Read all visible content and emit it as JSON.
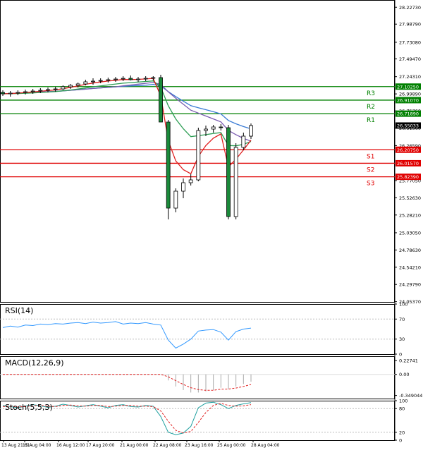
{
  "chart_data": {
    "type": "candlestick",
    "price_axis_ticks": [
      "28.22730",
      "27.98790",
      "27.73080",
      "27.49470",
      "27.24310",
      "26.99890",
      "26.75760",
      "26.51560",
      "26.26590",
      "25.77050",
      "25.52630",
      "25.28210",
      "25.03050",
      "24.78630",
      "24.54210",
      "24.29790",
      "24.05370"
    ],
    "x_ticks": [
      "13 Aug 21:01",
      "15 Aug 04:00",
      "16 Aug 12:00",
      "17 Aug 20:00",
      "21 Aug 00:00",
      "22 Aug 08:00",
      "23 Aug 16:00",
      "25 Aug 00:00",
      "28 Aug 04:00"
    ],
    "current_price": "26.55033",
    "price_range": [
      24.05,
      28.33
    ],
    "levels": [
      {
        "label": "R3",
        "value": "27.10250",
        "color": "#008000"
      },
      {
        "label": "R2",
        "value": "26.91070",
        "color": "#008000"
      },
      {
        "label": "R1",
        "value": "26.71890",
        "color": "#008000"
      },
      {
        "label": "S1",
        "value": "26.20750",
        "color": "#e00000"
      },
      {
        "label": "S2",
        "value": "26.01570",
        "color": "#e00000"
      },
      {
        "label": "S3",
        "value": "25.82390",
        "color": "#e00000"
      }
    ],
    "candles": [
      [
        27.02,
        27.05,
        26.97,
        27.0
      ],
      [
        27.0,
        27.04,
        26.96,
        27.01
      ],
      [
        27.01,
        27.05,
        26.98,
        27.02
      ],
      [
        27.02,
        27.06,
        26.99,
        27.03
      ],
      [
        27.03,
        27.07,
        27.0,
        27.04
      ],
      [
        27.04,
        27.08,
        27.01,
        27.05
      ],
      [
        27.05,
        27.09,
        27.02,
        27.06
      ],
      [
        27.06,
        27.1,
        27.03,
        27.07
      ],
      [
        27.07,
        27.12,
        27.05,
        27.1
      ],
      [
        27.1,
        27.14,
        27.07,
        27.12
      ],
      [
        27.12,
        27.16,
        27.09,
        27.14
      ],
      [
        27.14,
        27.2,
        27.12,
        27.17
      ],
      [
        27.17,
        27.22,
        27.13,
        27.18
      ],
      [
        27.18,
        27.22,
        27.15,
        27.19
      ],
      [
        27.19,
        27.23,
        27.16,
        27.2
      ],
      [
        27.2,
        27.24,
        27.17,
        27.21
      ],
      [
        27.21,
        27.25,
        27.18,
        27.22
      ],
      [
        27.22,
        27.26,
        27.19,
        27.2
      ],
      [
        27.2,
        27.24,
        27.17,
        27.21
      ],
      [
        27.21,
        27.25,
        27.18,
        27.22
      ],
      [
        27.22,
        27.25,
        27.19,
        27.23
      ],
      [
        27.23,
        27.27,
        27.18,
        26.6
      ],
      [
        26.6,
        26.63,
        25.22,
        25.38
      ],
      [
        25.38,
        25.66,
        25.32,
        25.62
      ],
      [
        25.62,
        25.8,
        25.52,
        25.74
      ],
      [
        25.74,
        25.86,
        25.7,
        25.78
      ],
      [
        25.78,
        26.52,
        25.76,
        26.48
      ],
      [
        26.48,
        26.55,
        26.4,
        26.5
      ],
      [
        26.5,
        26.56,
        26.45,
        26.53
      ],
      [
        26.53,
        26.57,
        26.48,
        26.52
      ],
      [
        26.52,
        26.56,
        25.22,
        25.26
      ],
      [
        25.26,
        26.3,
        25.22,
        26.24
      ],
      [
        26.24,
        26.45,
        26.2,
        26.4
      ],
      [
        26.4,
        26.58,
        26.36,
        26.55
      ]
    ],
    "indicators": [
      {
        "name": "RSI(14)",
        "ticks": [
          "100",
          "70",
          "30",
          "0"
        ],
        "range": [
          0,
          100
        ]
      },
      {
        "name": "MACD(12,26,9)",
        "ticks": [
          "0.22741",
          "0.00",
          "-0.349044"
        ],
        "range": [
          -0.4,
          0.3
        ]
      },
      {
        "name": "Stoch(5,5,3)",
        "ticks": [
          "100",
          "80",
          "20",
          "0"
        ],
        "range": [
          0,
          100
        ]
      }
    ],
    "rsi": [
      53,
      56,
      54,
      58,
      57,
      60,
      59,
      61,
      60,
      62,
      63,
      61,
      64,
      62,
      63,
      65,
      60,
      62,
      61,
      63,
      60,
      58,
      28,
      12,
      20,
      30,
      46,
      48,
      49,
      44,
      28,
      45,
      50,
      52
    ],
    "macd_hist": [
      0,
      0,
      0,
      0,
      0,
      0,
      0,
      0,
      0,
      0,
      0,
      0,
      0,
      0,
      0,
      0,
      0,
      0,
      0,
      0,
      0,
      0,
      -0.1,
      -0.2,
      -0.26,
      -0.3,
      -0.3,
      -0.28,
      -0.26,
      -0.22,
      -0.24,
      -0.2,
      -0.16,
      -0.12
    ],
    "stoch_k": [
      88,
      85,
      82,
      86,
      90,
      87,
      83,
      86,
      91,
      88,
      84,
      87,
      90,
      86,
      82,
      88,
      90,
      85,
      84,
      88,
      86,
      60,
      20,
      14,
      18,
      35,
      82,
      94,
      96,
      90,
      80,
      88,
      92,
      95
    ],
    "stoch_d": [
      85,
      86,
      84,
      85,
      87,
      88,
      86,
      85,
      88,
      89,
      87,
      86,
      88,
      88,
      85,
      86,
      88,
      88,
      86,
      86,
      85,
      74,
      48,
      25,
      18,
      22,
      45,
      70,
      88,
      93,
      88,
      86,
      87,
      90
    ]
  }
}
